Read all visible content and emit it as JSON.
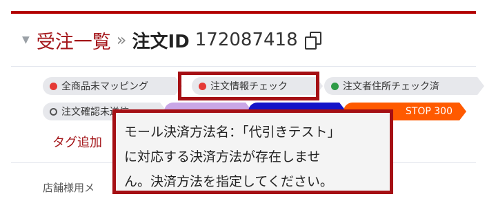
{
  "header": {
    "breadcrumb_link": "受注一覧",
    "separator": "»",
    "title": "注文ID",
    "order_id": "172087418"
  },
  "tags": [
    {
      "label": "全商品未マッピング",
      "dot": "red"
    },
    {
      "label": "注文情報チェック",
      "dot": "red"
    },
    {
      "label": "注文者住所チェック済",
      "dot": "green"
    },
    {
      "label": "注文確認未送信",
      "dot": "outline"
    },
    {
      "label": "",
      "dot": "none",
      "color": "#c9a6e6"
    },
    {
      "label": "",
      "dot": "none",
      "color": "#1414c8"
    },
    {
      "label": "STOP 300",
      "dot": "none",
      "color": "#ff5a00"
    }
  ],
  "add_tag_label": "タグ追加",
  "tooltip": {
    "lines": [
      "モール決済方法名：「代引きテスト」",
      "に対応する決済方法が存在しませ",
      "ん。決済方法を指定してください。"
    ]
  },
  "field_label": "店舗様用メ",
  "colors": {
    "accent": "#a4161a",
    "highlight_border": "#a50f14",
    "tag_bg": "#e7e8ec"
  }
}
